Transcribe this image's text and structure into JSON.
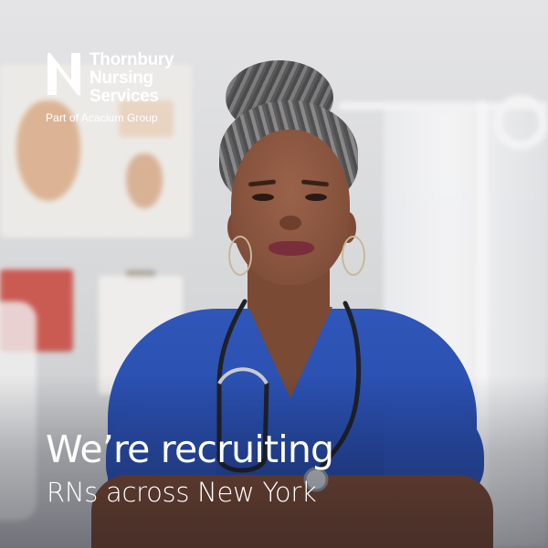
{
  "brand": {
    "name_lines": [
      "Thornbury",
      "Nursing",
      "Services"
    ],
    "tagline": "Part of Acacium Group",
    "logo_icon": "letter-n-logo-icon"
  },
  "headline": "We’re recruiting",
  "subheadline": "RNs across New York",
  "colors": {
    "text": "#ffffff",
    "scrubs": "#2a4fb0"
  }
}
